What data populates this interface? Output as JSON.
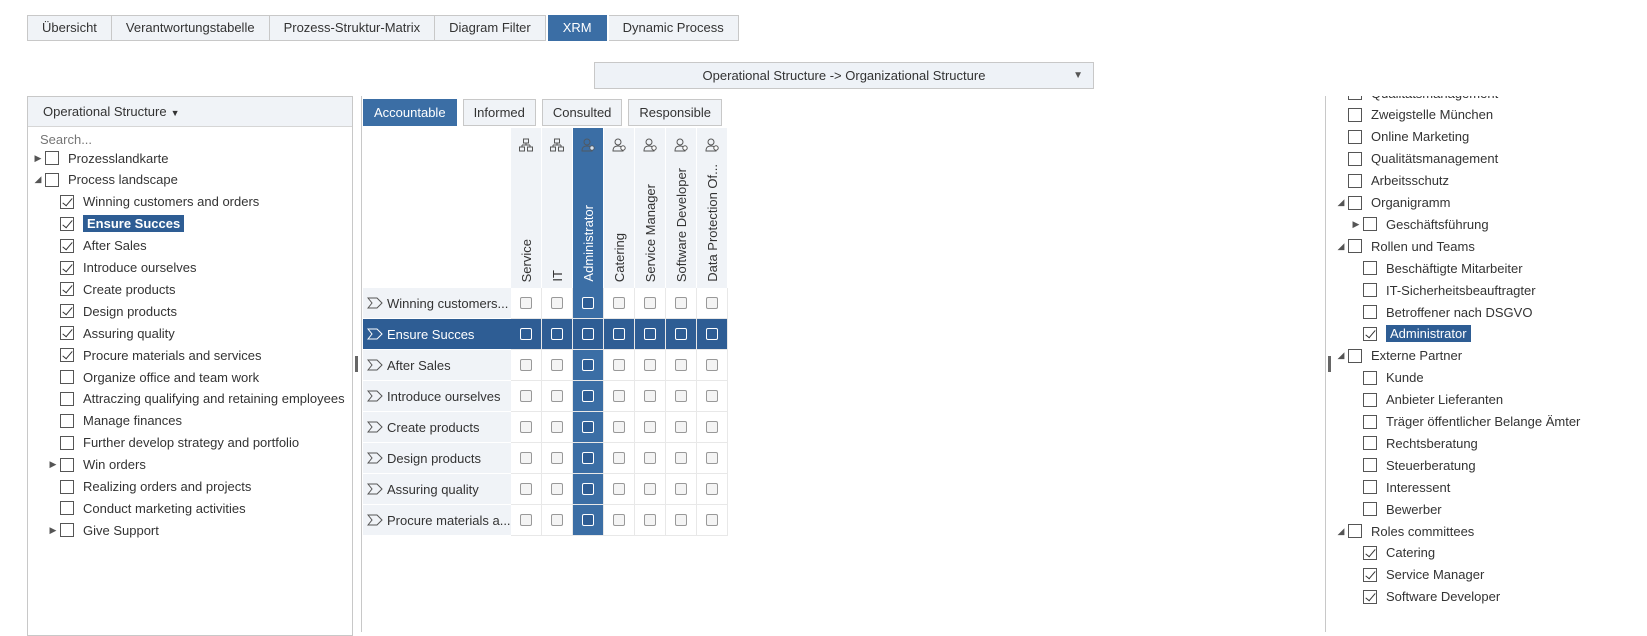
{
  "top_tabs": [
    "Übersicht",
    "Verantwortungstabelle",
    "Prozess-Struktur-Matrix",
    "Diagram Filter",
    "XRM",
    "Dynamic Process"
  ],
  "active_top_tab": "XRM",
  "view_select": {
    "value": "Operational Structure -> Organizational Structure"
  },
  "left_panel": {
    "header": "Operational Structure",
    "search_placeholder": "Search...",
    "tree": [
      {
        "label": "Prozesslandkarte",
        "level": 0,
        "toggle": "collapsed",
        "checked": false
      },
      {
        "label": "Process landscape",
        "level": 0,
        "toggle": "expanded",
        "checked": false
      },
      {
        "label": "Winning customers and orders",
        "level": 1,
        "toggle": "",
        "checked": true
      },
      {
        "label": "Ensure Succes",
        "level": 1,
        "toggle": "",
        "checked": true,
        "selected": true
      },
      {
        "label": "After Sales",
        "level": 1,
        "toggle": "",
        "checked": true
      },
      {
        "label": "Introduce ourselves",
        "level": 1,
        "toggle": "",
        "checked": true
      },
      {
        "label": "Create products",
        "level": 1,
        "toggle": "",
        "checked": true
      },
      {
        "label": "Design products",
        "level": 1,
        "toggle": "",
        "checked": true
      },
      {
        "label": "Assuring quality",
        "level": 1,
        "toggle": "",
        "checked": true
      },
      {
        "label": "Procure materials and services",
        "level": 1,
        "toggle": "",
        "checked": true
      },
      {
        "label": "Organize office and team work",
        "level": 1,
        "toggle": "",
        "checked": false
      },
      {
        "label": "Attraczing qualifying and retaining employees",
        "level": 1,
        "toggle": "",
        "checked": false
      },
      {
        "label": "Manage finances",
        "level": 1,
        "toggle": "",
        "checked": false
      },
      {
        "label": "Further develop strategy and portfolio",
        "level": 1,
        "toggle": "",
        "checked": false
      },
      {
        "label": "Win orders",
        "level": 1,
        "toggle": "collapsed",
        "checked": false
      },
      {
        "label": "Realizing orders and projects",
        "level": 1,
        "toggle": "",
        "checked": false
      },
      {
        "label": "Conduct marketing activities",
        "level": 1,
        "toggle": "",
        "checked": false
      },
      {
        "label": "Give Support",
        "level": 1,
        "toggle": "collapsed",
        "checked": false
      }
    ]
  },
  "raci_tabs": [
    "Accountable",
    "Informed",
    "Consulted",
    "Responsible"
  ],
  "active_raci_tab": "Accountable",
  "matrix": {
    "columns": [
      {
        "label": "Service",
        "icon": "org-unit-icon",
        "highlighted": false
      },
      {
        "label": "IT",
        "icon": "org-unit-icon",
        "highlighted": false
      },
      {
        "label": "Administrator",
        "icon": "role-icon",
        "highlighted": true
      },
      {
        "label": "Catering",
        "icon": "role-icon",
        "highlighted": false
      },
      {
        "label": "Service Manager",
        "icon": "role-icon",
        "highlighted": false
      },
      {
        "label": "Software Developer",
        "icon": "role-icon",
        "highlighted": false
      },
      {
        "label": "Data Protection Of...",
        "icon": "role-icon",
        "highlighted": false
      }
    ],
    "rows": [
      {
        "label": "Winning customers...",
        "selected": false
      },
      {
        "label": "Ensure Succes",
        "selected": true
      },
      {
        "label": "After Sales",
        "selected": false
      },
      {
        "label": "Introduce ourselves",
        "selected": false
      },
      {
        "label": "Create products",
        "selected": false
      },
      {
        "label": "Design products",
        "selected": false
      },
      {
        "label": "Assuring quality",
        "selected": false
      },
      {
        "label": "Procure materials a...",
        "selected": false
      }
    ]
  },
  "right_panel": {
    "tree": [
      {
        "label": "Qualitätsmanagement",
        "level": 0,
        "toggle": "",
        "checked": false,
        "partial": true
      },
      {
        "label": "Zweigstelle München",
        "level": 0,
        "toggle": "",
        "checked": false
      },
      {
        "label": "Online Marketing",
        "level": 0,
        "toggle": "",
        "checked": false
      },
      {
        "label": "Qualitätsmanagement",
        "level": 0,
        "toggle": "",
        "checked": false
      },
      {
        "label": "Arbeitsschutz",
        "level": 0,
        "toggle": "",
        "checked": false
      },
      {
        "label": "Organigramm",
        "level": 0,
        "toggle": "expanded",
        "checked": false
      },
      {
        "label": "Geschäftsführung",
        "level": 1,
        "toggle": "collapsed",
        "checked": false
      },
      {
        "label": "Rollen und Teams",
        "level": 0,
        "toggle": "expanded",
        "checked": false
      },
      {
        "label": "Beschäftigte Mitarbeiter",
        "level": 1,
        "toggle": "",
        "checked": false
      },
      {
        "label": "IT-Sicherheitsbeauftragter",
        "level": 1,
        "toggle": "",
        "checked": false
      },
      {
        "label": "Betroffener nach DSGVO",
        "level": 1,
        "toggle": "",
        "checked": false
      },
      {
        "label": "Administrator",
        "level": 1,
        "toggle": "",
        "checked": true,
        "selected": true
      },
      {
        "label": "Externe Partner",
        "level": 0,
        "toggle": "expanded",
        "checked": false
      },
      {
        "label": "Kunde",
        "level": 1,
        "toggle": "",
        "checked": false
      },
      {
        "label": "Anbieter Lieferanten",
        "level": 1,
        "toggle": "",
        "checked": false
      },
      {
        "label": "Träger öffentlicher Belange Ämter",
        "level": 1,
        "toggle": "",
        "checked": false
      },
      {
        "label": "Rechtsberatung",
        "level": 1,
        "toggle": "",
        "checked": false
      },
      {
        "label": "Steuerberatung",
        "level": 1,
        "toggle": "",
        "checked": false
      },
      {
        "label": "Interessent",
        "level": 1,
        "toggle": "",
        "checked": false
      },
      {
        "label": "Bewerber",
        "level": 1,
        "toggle": "",
        "checked": false
      },
      {
        "label": "Roles committees",
        "level": 0,
        "toggle": "expanded",
        "checked": false
      },
      {
        "label": "Catering",
        "level": 1,
        "toggle": "",
        "checked": true
      },
      {
        "label": "Service Manager",
        "level": 1,
        "toggle": "",
        "checked": true
      },
      {
        "label": "Software Developer",
        "level": 1,
        "toggle": "",
        "checked": true
      }
    ]
  },
  "colors": {
    "accent": "#3b6ea5",
    "selected": "#2e5d94",
    "header_bg": "#f0f3f7"
  }
}
